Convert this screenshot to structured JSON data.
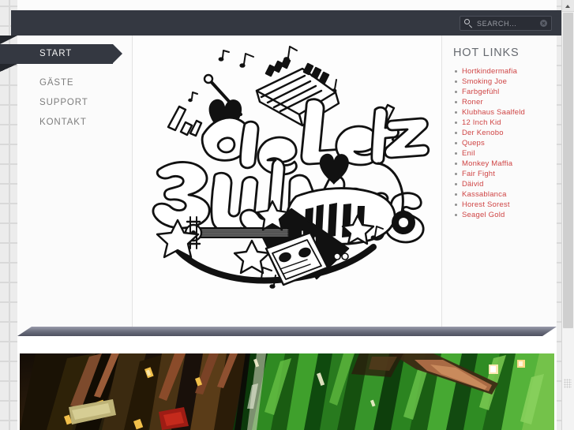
{
  "header": {
    "search": {
      "placeholder": "SEARCH...",
      "value": "",
      "icon": "search-icon",
      "clear_icon": "clear-circle-icon"
    }
  },
  "sidebar": {
    "items": [
      {
        "label": "START",
        "active": true
      },
      {
        "label": "GÄSTE",
        "active": false
      },
      {
        "label": "SUPPORT",
        "active": false
      },
      {
        "label": "KONTAKT",
        "active": false
      }
    ]
  },
  "content": {
    "artwork": {
      "alt": "Graffiti lettering artwork",
      "line1": "Die Letzten",
      "line2": "zu J Musikanten",
      "elements": [
        "keyboard",
        "flying-v-guitar",
        "cassette-tape",
        "stars",
        "hearts",
        "music-notes"
      ]
    }
  },
  "hot_links": {
    "title": "HOT LINKS",
    "items": [
      "Hortkindermafia",
      "Smoking Joe",
      "Farbgefühl",
      "Roner",
      "Klubhaus Saalfeld",
      "12 Inch Kid",
      "Der Kenobo",
      "Queps",
      "Enil",
      "Monkey Maffia",
      "Fair Fight",
      "Däivid",
      "Kassablanca",
      "Horest Sorest",
      "Seagel Gold"
    ]
  },
  "footer_banner": {
    "alt": "Abstract green extruded pixel photo banner"
  },
  "colors": {
    "header_bar": "#343841",
    "link_red": "#cf4545",
    "nav_text": "#7d7d7d",
    "page_bg": "#ececec",
    "sheet": "#fdfdfd"
  }
}
